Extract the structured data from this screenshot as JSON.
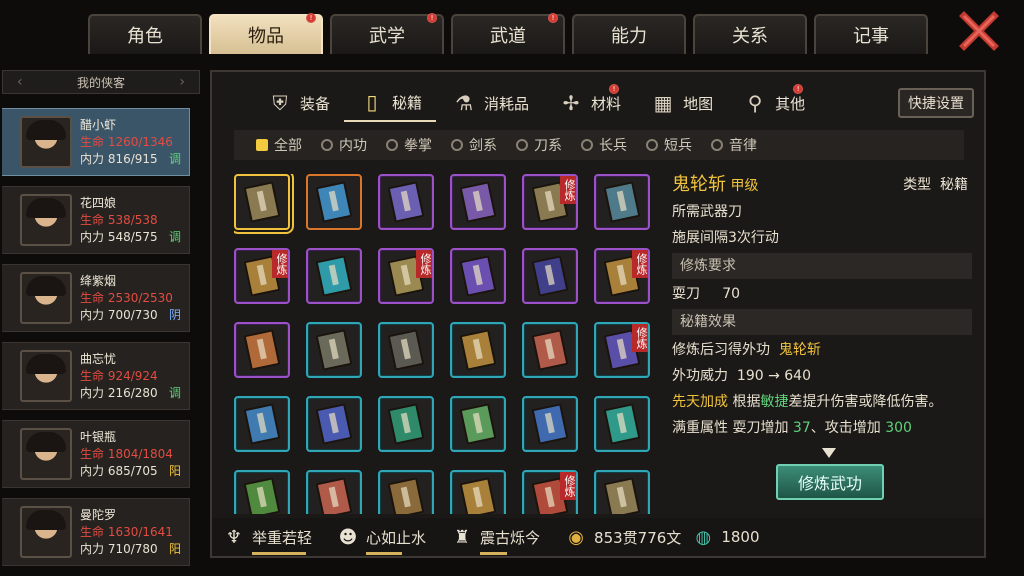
{
  "top_tabs": [
    {
      "label": "角色",
      "active": false,
      "badge": false
    },
    {
      "label": "物品",
      "active": true,
      "badge": true
    },
    {
      "label": "武学",
      "active": false,
      "badge": true
    },
    {
      "label": "武道",
      "active": false,
      "badge": true
    },
    {
      "label": "能力",
      "active": false,
      "badge": false
    },
    {
      "label": "关系",
      "active": false,
      "badge": false
    },
    {
      "label": "记事",
      "active": false,
      "badge": false
    }
  ],
  "roster": {
    "header": "我的侠客",
    "characters": [
      {
        "name": "醋小虾",
        "hp": "生命 1260/1346",
        "mp": "内力 816/915",
        "tag": "调",
        "tag_color": "#5fd17a",
        "active": true
      },
      {
        "name": "花四娘",
        "hp": "生命 538/538",
        "mp": "内力 548/575",
        "tag": "调",
        "tag_color": "#5fd17a",
        "active": false
      },
      {
        "name": "绛紫烟",
        "hp": "生命 2530/2530",
        "mp": "内力 700/730",
        "tag": "阴",
        "tag_color": "#7fb0ff",
        "active": false
      },
      {
        "name": "曲忘忧",
        "hp": "生命 924/924",
        "mp": "内力 216/280",
        "tag": "调",
        "tag_color": "#5fd17a",
        "active": false
      },
      {
        "name": "叶银瓶",
        "hp": "生命 1804/1804",
        "mp": "内力 685/705",
        "tag": "阳",
        "tag_color": "#f0c33c",
        "active": false
      },
      {
        "name": "曼陀罗",
        "hp": "生命 1630/1641",
        "mp": "内力 710/780",
        "tag": "阳",
        "tag_color": "#f0c33c",
        "active": false
      }
    ]
  },
  "sub_tabs": [
    {
      "label": "装备",
      "icon": "armor-icon",
      "glyph": "⛨",
      "active": false,
      "badge": false
    },
    {
      "label": "秘籍",
      "icon": "manual-icon",
      "glyph": "▯",
      "active": true,
      "badge": false
    },
    {
      "label": "消耗品",
      "icon": "potion-icon",
      "glyph": "⚗",
      "active": false,
      "badge": false
    },
    {
      "label": "材料",
      "icon": "material-icon",
      "glyph": "✢",
      "active": false,
      "badge": true
    },
    {
      "label": "地图",
      "icon": "map-icon",
      "glyph": "▦",
      "active": false,
      "badge": false
    },
    {
      "label": "其他",
      "icon": "misc-icon",
      "glyph": "⚲",
      "active": false,
      "badge": true
    }
  ],
  "quick_settings": "快捷设置",
  "filters": [
    "全部",
    "内功",
    "拳掌",
    "剑系",
    "刀系",
    "长兵",
    "短兵",
    "音律"
  ],
  "selected_filter": 0,
  "items": [
    {
      "frame": "orange",
      "color": "#8a7a52",
      "badge": "",
      "selected": true
    },
    {
      "frame": "orange",
      "color": "#3f86b8",
      "badge": ""
    },
    {
      "frame": "purple",
      "color": "#6a5fb0",
      "badge": ""
    },
    {
      "frame": "purple",
      "color": "#7859a8",
      "badge": ""
    },
    {
      "frame": "purple",
      "color": "#8a7a52",
      "badge": "修炼"
    },
    {
      "frame": "purple",
      "color": "#4f7a8a",
      "badge": ""
    },
    {
      "frame": "purple",
      "color": "#a8803a",
      "badge": "修炼"
    },
    {
      "frame": "purple",
      "color": "#2f9aa8",
      "badge": ""
    },
    {
      "frame": "purple",
      "color": "#9a8a52",
      "badge": "修炼"
    },
    {
      "frame": "purple",
      "color": "#6a4fb0",
      "badge": ""
    },
    {
      "frame": "purple",
      "color": "#3f3f8a",
      "badge": ""
    },
    {
      "frame": "purple",
      "color": "#a8803a",
      "badge": "修炼"
    },
    {
      "frame": "purple",
      "color": "#b06a3a",
      "badge": ""
    },
    {
      "frame": "teal",
      "color": "#6a6a5a",
      "badge": ""
    },
    {
      "frame": "teal",
      "color": "#5a5a52",
      "badge": ""
    },
    {
      "frame": "teal",
      "color": "#a8803a",
      "badge": ""
    },
    {
      "frame": "teal",
      "color": "#b05a4a",
      "badge": ""
    },
    {
      "frame": "teal",
      "color": "#5a4fa8",
      "badge": "修炼"
    },
    {
      "frame": "teal",
      "color": "#3f7ab0",
      "badge": ""
    },
    {
      "frame": "teal",
      "color": "#4a5ab0",
      "badge": ""
    },
    {
      "frame": "teal",
      "color": "#2f8a6a",
      "badge": ""
    },
    {
      "frame": "teal",
      "color": "#5a9a5a",
      "badge": ""
    },
    {
      "frame": "teal",
      "color": "#3f6ab0",
      "badge": ""
    },
    {
      "frame": "teal",
      "color": "#2f9a8a",
      "badge": ""
    },
    {
      "frame": "teal",
      "color": "#4f8a3f",
      "badge": ""
    },
    {
      "frame": "teal",
      "color": "#b05a4a",
      "badge": ""
    },
    {
      "frame": "teal",
      "color": "#8a6a3a",
      "badge": ""
    },
    {
      "frame": "teal",
      "color": "#a8803a",
      "badge": ""
    },
    {
      "frame": "teal",
      "color": "#b04a3a",
      "badge": "修炼"
    },
    {
      "frame": "teal",
      "color": "#8a7a52",
      "badge": ""
    }
  ],
  "detail": {
    "name": "鬼轮斩",
    "grade": "甲级",
    "type_label": "类型",
    "type_value": "秘籍",
    "weapon_line": "所需武器刀",
    "interval_line": "施展间隔3次行动",
    "req_header": "修炼要求",
    "req_skill": "耍刀",
    "req_value": "70",
    "effect_header": "秘籍效果",
    "learn_prefix": "修炼后习得外功",
    "learn_skill": "鬼轮斩",
    "power_label": "外功威力",
    "power_value": "190 → 640",
    "innate_label": "先天加成",
    "innate_prefix": "根据",
    "innate_attr": "敏捷",
    "innate_suffix": "差提升伤害或降低伤害。",
    "full_label": "满重属性",
    "full_text1": "耍刀增加",
    "full_val1": "37",
    "full_text2": "、攻击增加",
    "full_val2": "300",
    "learn_button": "修炼武功"
  },
  "status": [
    {
      "icon": "strength-icon",
      "glyph": "♆",
      "label": "举重若轻",
      "progress": 0.6
    },
    {
      "icon": "calm-icon",
      "glyph": "☻",
      "label": "心如止水",
      "progress": 0.4
    },
    {
      "icon": "forge-icon",
      "glyph": "♜",
      "label": "震古烁今",
      "progress": 0.3
    }
  ],
  "currency": {
    "coins": "853贯776文",
    "jade": "1800"
  },
  "colors": {
    "accent": "#f0c33c",
    "hp": "#e24c42",
    "purple_frame": "#9b52c7",
    "teal_frame": "#2fa7b7"
  }
}
